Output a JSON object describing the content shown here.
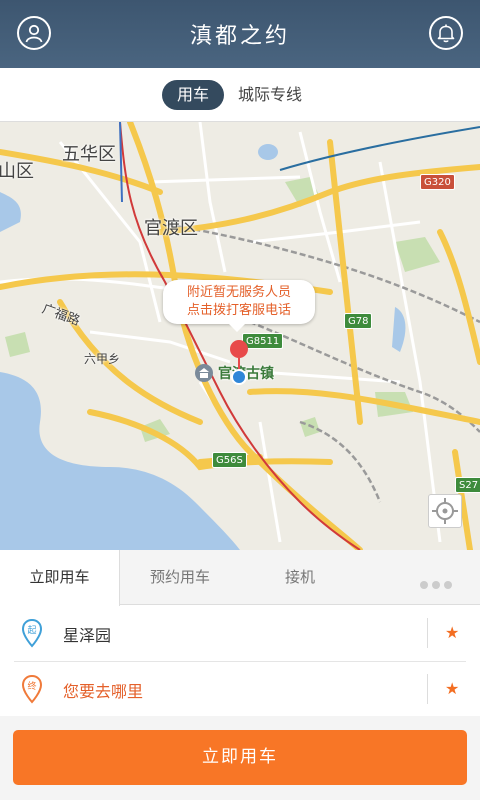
{
  "header": {
    "title": "滇都之约",
    "left_icon": "user-profile-icon",
    "right_icon": "bell-icon"
  },
  "service_tabs": [
    {
      "label": "用车",
      "active": true
    },
    {
      "label": "城际专线",
      "active": false
    }
  ],
  "map": {
    "notice_line1": "附近暂无服务人员",
    "notice_line2": "点击拨打客服电话",
    "labels": {
      "district_wuhua": "五华区",
      "district_guandu": "官渡区",
      "district_left": "山区",
      "road_guangfu": "广福路",
      "township_liujia": "六甲乡",
      "poi_town": "官渡古镇"
    },
    "highway_shields": [
      "G8511",
      "G78",
      "G320",
      "G56S",
      "S27"
    ],
    "locate_icon": "crosshair-icon"
  },
  "mode_tabs": [
    {
      "label": "立即用车",
      "active": true
    },
    {
      "label": "预约用车",
      "active": false
    },
    {
      "label": "接机",
      "active": false
    }
  ],
  "locations": {
    "start": {
      "badge": "起",
      "text": "星泽园"
    },
    "end": {
      "badge": "终",
      "text": "您要去哪里"
    }
  },
  "action_button": {
    "label": "立即用车"
  },
  "colors": {
    "header_bg": "#3d5670",
    "accent_orange": "#f87626",
    "start_pin": "#3fa0d8",
    "end_pin": "#f07a3a"
  }
}
